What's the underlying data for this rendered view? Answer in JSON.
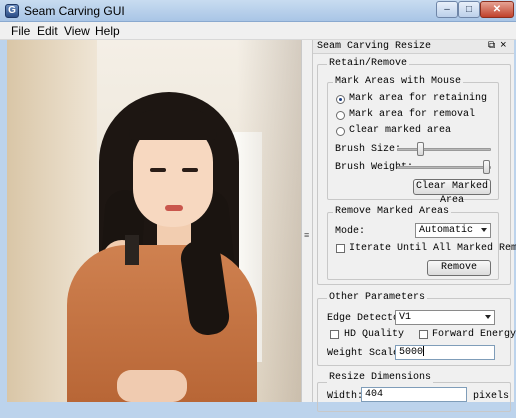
{
  "window": {
    "title": "Seam Carving GUI",
    "icon_letter": "G",
    "minimize_glyph": "–",
    "maximize_glyph": "□",
    "close_glyph": "✕"
  },
  "menu": {
    "items": [
      "File",
      "Edit",
      "View",
      "Help"
    ]
  },
  "splitter": {
    "grip": "≡"
  },
  "dock": {
    "title": "Seam Carving Resize",
    "float_glyph": "⧉",
    "close_glyph": "×",
    "retain_remove": {
      "title": "Retain/Remove",
      "mark_group": {
        "title": "Mark Areas with Mouse",
        "options": [
          "Mark area for retaining",
          "Mark area for removal",
          "Clear marked area"
        ],
        "selected_index": 0,
        "brush_size_label": "Brush Size:",
        "brush_size_value": 0.2,
        "brush_weight_label": "Brush Weight:",
        "brush_weight_value": 1.0,
        "clear_button": "Clear Marked Area"
      },
      "remove_group": {
        "title": "Remove Marked Areas",
        "mode_label": "Mode:",
        "mode_value": "Automatic",
        "iterate_label": "Iterate Until All Marked Removed",
        "iterate_checked": false,
        "remove_button": "Remove"
      }
    },
    "other_params": {
      "title": "Other Parameters",
      "edge_detector_label": "Edge Detector:",
      "edge_detector_value": "V1",
      "hd_quality_label": "HD Quality",
      "hd_quality_checked": false,
      "forward_energy_label": "Forward Energy",
      "forward_energy_checked": false,
      "weight_scale_label": "Weight Scale:",
      "weight_scale_value": "5000"
    },
    "resize_dims": {
      "title": "Resize Dimensions",
      "width_label": "Width:",
      "width_value": "404",
      "width_unit": "pixels"
    }
  }
}
